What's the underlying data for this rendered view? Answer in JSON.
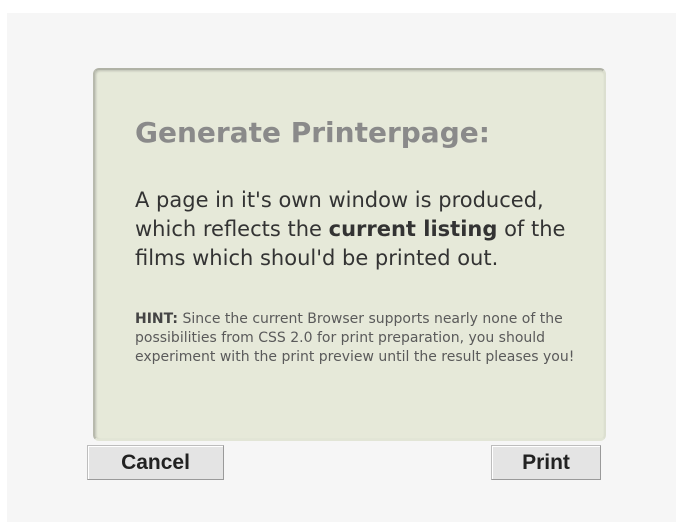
{
  "panel": {
    "title": "Generate Printerpage:",
    "description": {
      "before": "A page in it's own window is produced, which reflects the ",
      "bold": "current listing",
      "after": " of the films which shoul'd be printed out."
    },
    "hint": {
      "label": "HINT:",
      "text": " Since the current Browser supports nearly none of the possibilities from CSS 2.0 for print preparation, you should experiment with the print preview until the result pleases you!"
    }
  },
  "buttons": {
    "cancel_label": "Cancel",
    "print_label": "Print"
  }
}
